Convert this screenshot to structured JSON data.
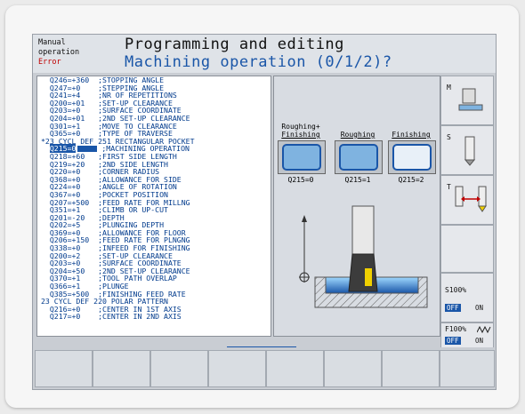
{
  "header": {
    "mode_line1": "Manual",
    "mode_line2": "operation",
    "mode_status": "Error",
    "title": "Programming and editing",
    "subtitle": "Machining operation (0/1/2)?"
  },
  "program_lines": [
    "  Q246=+360  ;STOPPING ANGLE",
    "  Q247=+0    ;STEPPING ANGLE",
    "  Q241=+4    ;NR OF REPETITIONS",
    "  Q200=+01   ;SET-UP CLEARANCE",
    "  Q203=+0    ;SURFACE COORDINATE",
    "  Q204=+01   ;2ND SET-UP CLEARANCE",
    "  Q301=+1    ;MOVE TO CLEARANCE",
    "  Q365=+0    ;TYPE OF TRAVERSE",
    "*23 CYCL DEF 251 RECTANGULAR POCKET",
    "  Q215=0     ;MACHINING OPERATION",
    "  Q218=+60   ;FIRST SIDE LENGTH",
    "  Q219=+20   ;2ND SIDE LENGTH",
    "  Q220=+0    ;CORNER RADIUS",
    "  Q368=+0    ;ALLOWANCE FOR SIDE",
    "  Q224=+0    ;ANGLE OF ROTATION",
    "  Q367=+0    ;POCKET POSITION",
    "  Q207=+500  ;FEED RATE FOR MILLNG",
    "  Q351=+1    ;CLIMB OR UP-CUT",
    "  Q201=-20   ;DEPTH",
    "  Q202=+5    ;PLUNGING DEPTH",
    "  Q369=+0    ;ALLOWANCE FOR FLOOR",
    "  Q206=+150  ;FEED RATE FOR PLNGNG",
    "  Q338=+0    ;INFEED FOR FINISHING",
    "  Q200=+2    ;SET-UP CLEARANCE",
    "  Q203=+0    ;SURFACE COORDINATE",
    "  Q204=+50   ;2ND SET-UP CLEARANCE",
    "  Q370=+1    ;TOOL PATH OVERLAP",
    "  Q366=+1    ;PLUNGE",
    "  Q385=+500  ;FINISHING FEED RATE",
    "23 CYCL DEF 220 POLAR PATTERN",
    "  Q216=+0    ;CENTER IN 1ST AXIS",
    "  Q217=+0    ;CENTER IN 2ND AXIS"
  ],
  "help": {
    "opt0_label1": "Roughing+",
    "opt0_label2": "Finishing",
    "opt1_label": "Roughing",
    "opt2_label": "Finishing",
    "opt0_value": "Q215=0",
    "opt1_value": "Q215=1",
    "opt2_value": "Q215=2"
  },
  "right_panel": {
    "m_label": "M",
    "s_label": "S",
    "t_label": "T",
    "spindle_override": "S100%",
    "feed_override": "F100%",
    "off_label": "OFF",
    "on_label": "ON"
  },
  "colors": {
    "accent": "#1a56a8",
    "error": "#c00000",
    "tool_highlight": "#f0d000"
  }
}
